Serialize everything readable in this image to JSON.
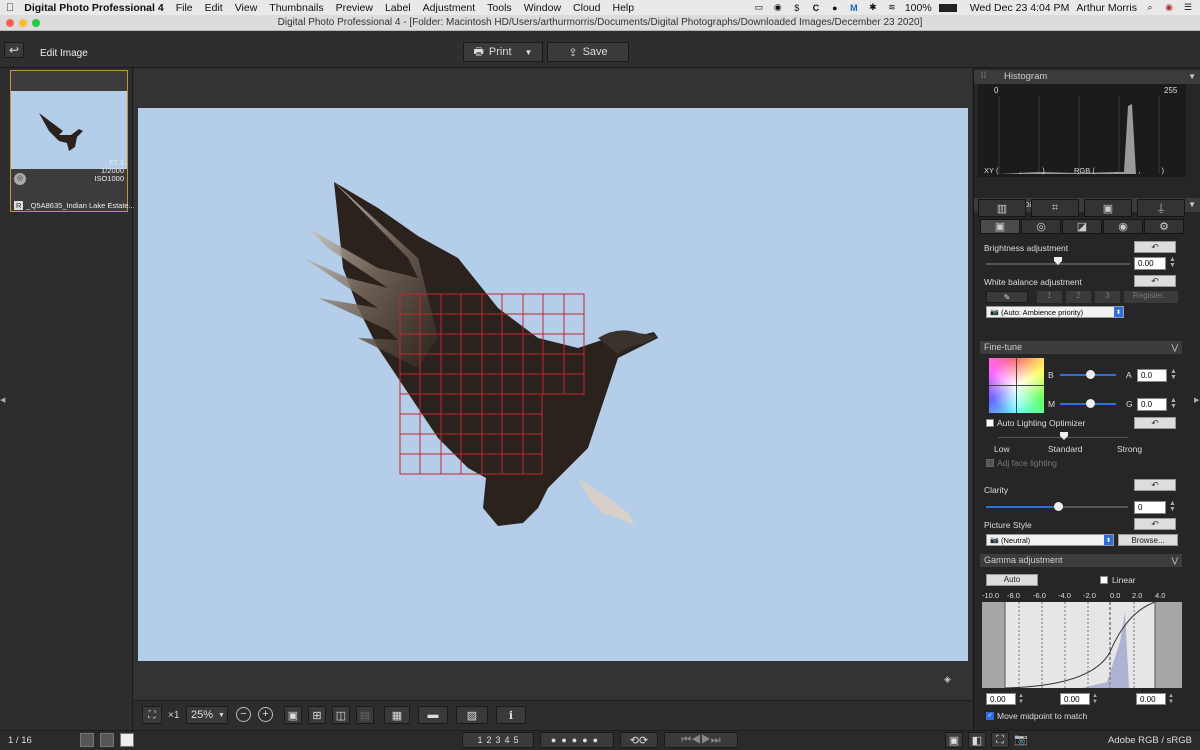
{
  "menubar": {
    "app": "Digital Photo Professional 4",
    "items": [
      "File",
      "Edit",
      "View",
      "Thumbnails",
      "Preview",
      "Label",
      "Adjustment",
      "Tools",
      "Window",
      "Cloud",
      "Help"
    ],
    "battery": "100%",
    "datetime": "Wed Dec 23  4:04 PM",
    "user": "Arthur Morris"
  },
  "window": {
    "title": "Digital Photo Professional 4 - [Folder: Macintosh HD/Users/arthurmorris/Documents/Digital Photographs/Downloaded Images/December 23 2020]"
  },
  "toolbar": {
    "mode": "Edit Image",
    "print": "Print",
    "save": "Save"
  },
  "thumbnail": {
    "info": [
      "F7.1",
      "1/2000",
      "ISO1000"
    ],
    "badge": "R",
    "filename": "_Q5A8635_Indian Lake Estate..."
  },
  "histogram": {
    "title": "Histogram",
    "min": "0",
    "max": "255",
    "xy": "XY (          ,          )",
    "rgb": "RGB (          ,          ,          )"
  },
  "tool_palette": {
    "title": "Tool palette"
  },
  "brightness": {
    "label": "Brightness adjustment",
    "value": "0.00",
    "level": 0.5
  },
  "wb": {
    "label": "White balance adjustment",
    "presets": [
      "1",
      "2",
      "3"
    ],
    "register": "Register...",
    "select": "(Auto: Ambience priority)"
  },
  "finetune": {
    "title": "Fine-tune",
    "b_label": "B",
    "a_label": "A",
    "a_value": "0.0",
    "m_label": "M",
    "g_label": "G",
    "g_value": "0.0"
  },
  "alo": {
    "label": "Auto Lighting Optimizer",
    "low": "Low",
    "standard": "Standard",
    "strong": "Strong",
    "face": "Adj face lighting"
  },
  "clarity": {
    "label": "Clarity",
    "value": "0"
  },
  "picture_style": {
    "label": "Picture Style",
    "select": "(Neutral)",
    "browse": "Browse..."
  },
  "gamma": {
    "title": "Gamma adjustment",
    "auto": "Auto",
    "linear": "Linear",
    "ticks": [
      "-10.0",
      "-8.0",
      "-6.0",
      "-4.0",
      "-2.0",
      "0.0",
      "2.0",
      "4.0"
    ],
    "vals": [
      "0.00",
      "0.00",
      "0.00"
    ],
    "midpoint": "Move midpoint to match"
  },
  "viewer": {
    "zoom": "25%",
    "zoom_x1": "×1"
  },
  "status": {
    "page": "1 / 16",
    "colorspace": "Adobe RGB / sRGB",
    "ratings": [
      "1",
      "2",
      "3",
      "4",
      "5"
    ]
  },
  "colors": {
    "accent": "#c9903d",
    "sky": "#b4cde9",
    "af_grid": "#c0282e"
  }
}
